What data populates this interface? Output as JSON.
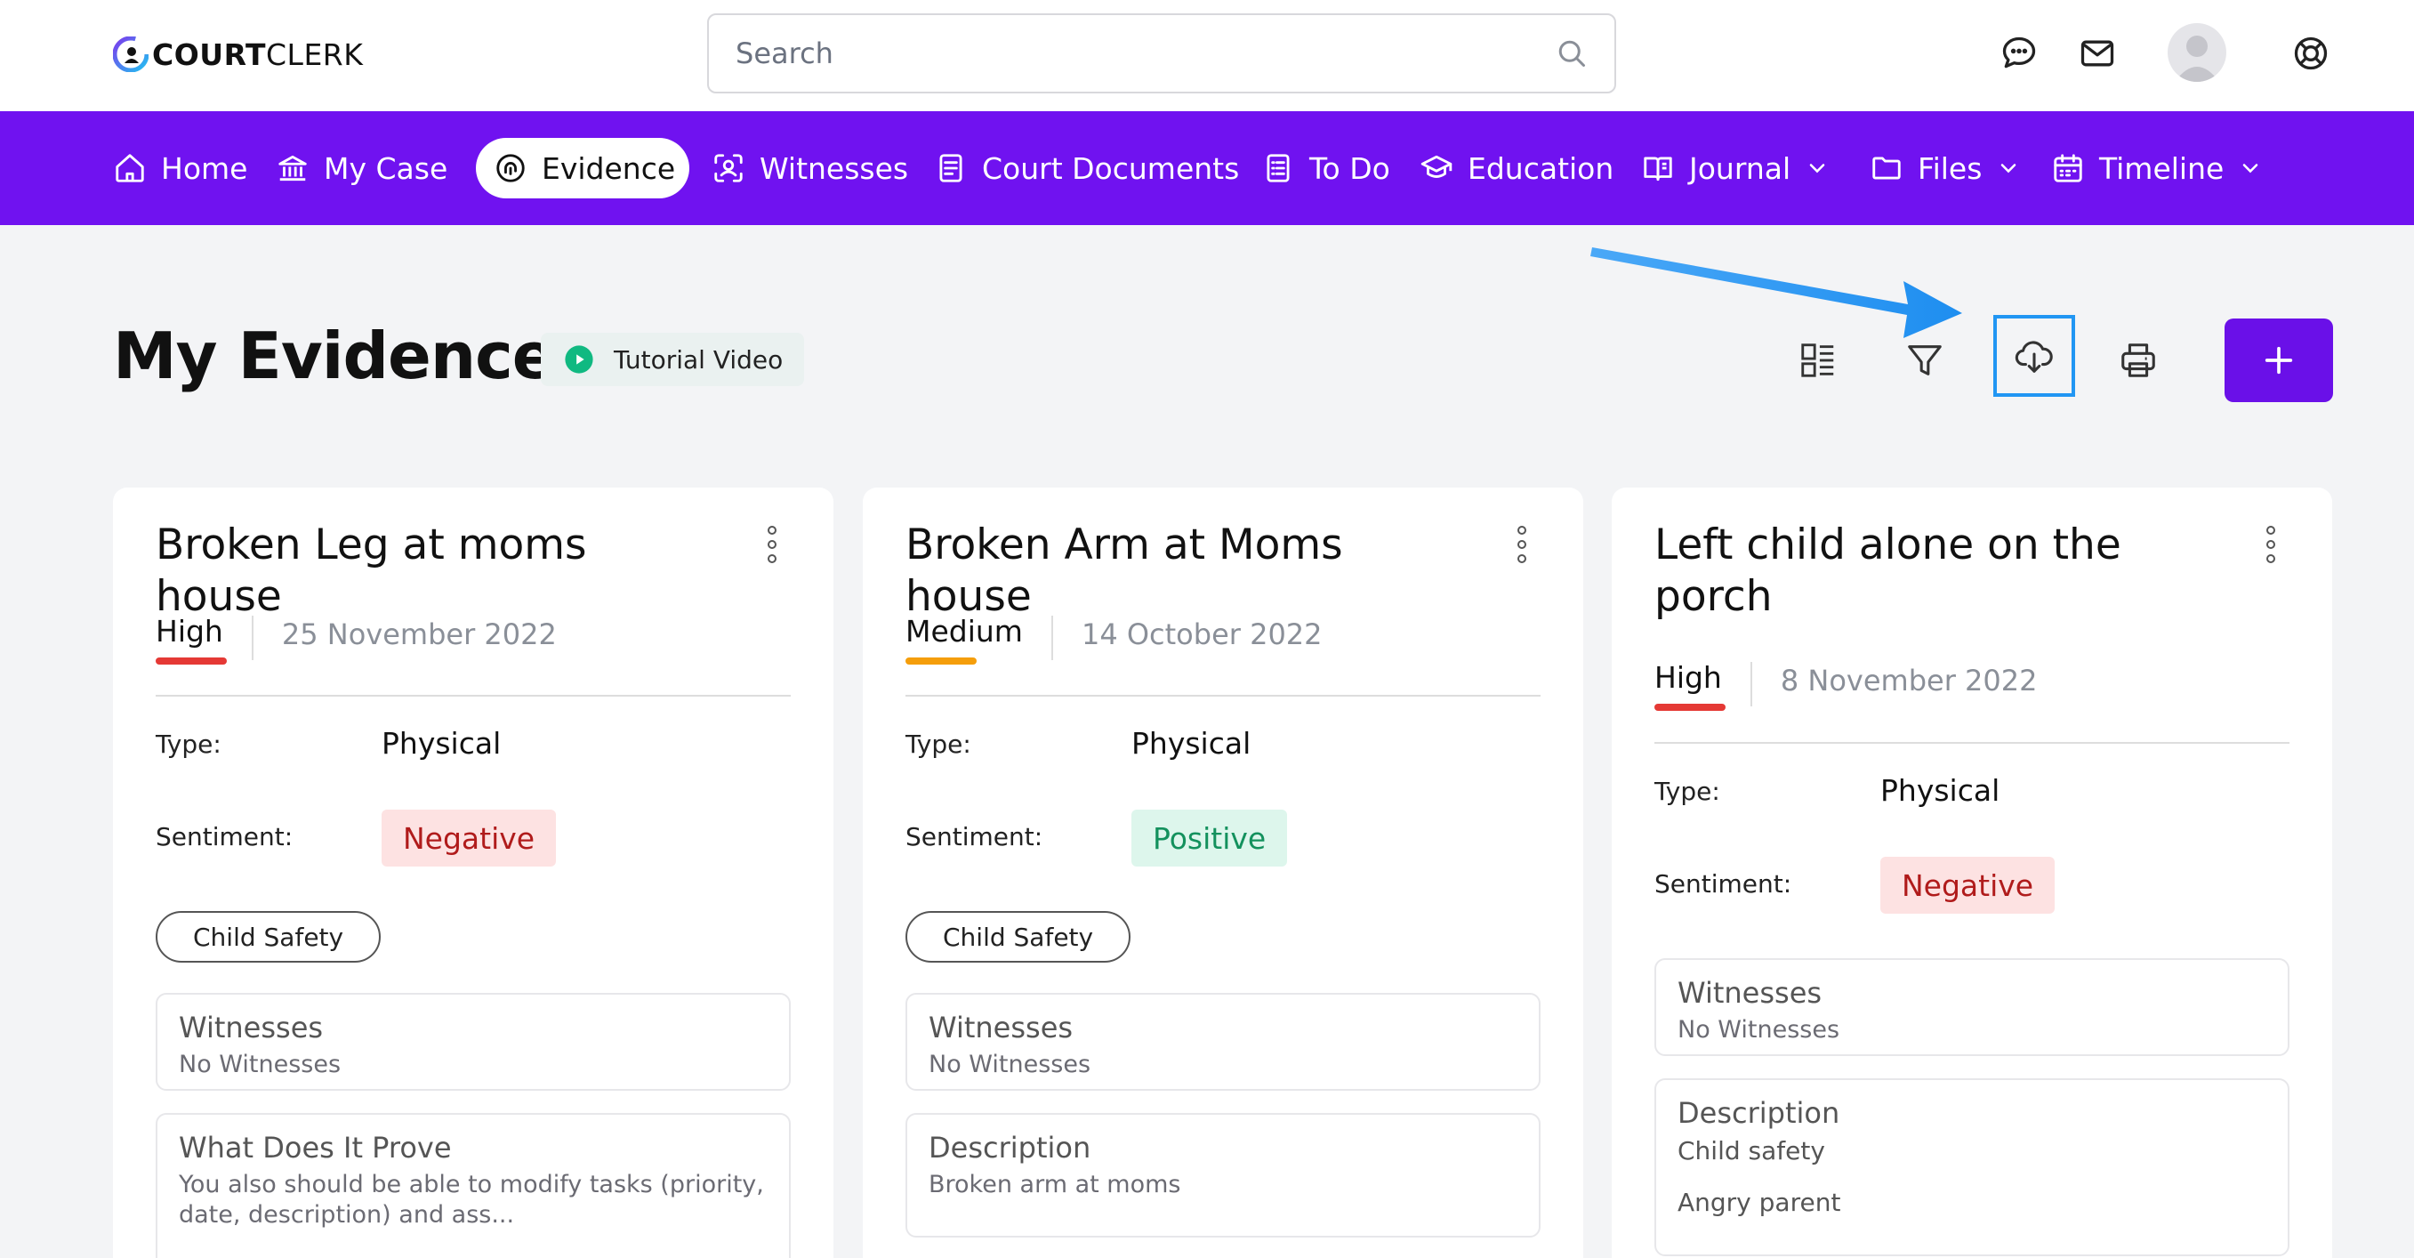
{
  "app": {
    "brand_bold": "COURT",
    "brand_light": "CLERK"
  },
  "search": {
    "placeholder": "Search"
  },
  "nav": {
    "items": [
      {
        "label": "Home"
      },
      {
        "label": "My Case"
      },
      {
        "label": "Evidence"
      },
      {
        "label": "Witnesses"
      },
      {
        "label": "Court Documents"
      },
      {
        "label": "To Do"
      },
      {
        "label": "Education"
      },
      {
        "label": "Journal"
      },
      {
        "label": "Files"
      },
      {
        "label": "Timeline"
      }
    ],
    "active": "Evidence"
  },
  "page": {
    "title": "My Evidence",
    "tutorial_label": "Tutorial Video"
  },
  "colors": {
    "brand": "#7012f0",
    "add_button": "#6a10e8",
    "highlight": "#2196f3",
    "priority_high": "#e53935",
    "priority_medium": "#f59e0b"
  },
  "cards": [
    {
      "title": "Broken Leg at moms house",
      "priority": "High",
      "date": "25 November 2022",
      "type_label": "Type:",
      "type_value": "Physical",
      "sentiment_label": "Sentiment:",
      "sentiment_value": "Negative",
      "tag": "Child Safety",
      "witnesses_title": "Witnesses",
      "witnesses_text": "No Witnesses",
      "box2_title": "What Does It Prove",
      "box2_text": "You also should be able to modify tasks (priority, date, description) and ass..."
    },
    {
      "title": "Broken Arm at Moms house",
      "priority": "Medium",
      "date": "14 October 2022",
      "type_label": "Type:",
      "type_value": "Physical",
      "sentiment_label": "Sentiment:",
      "sentiment_value": "Positive",
      "tag": "Child Safety",
      "witnesses_title": "Witnesses",
      "witnesses_text": "No Witnesses",
      "box2_title": "Description",
      "box2_text": "Broken arm at moms"
    },
    {
      "title": "Left child alone on the porch",
      "priority": "High",
      "date": "8 November 2022",
      "type_label": "Type:",
      "type_value": "Physical",
      "sentiment_label": "Sentiment:",
      "sentiment_value": "Negative",
      "witnesses_title": "Witnesses",
      "witnesses_text": "No Witnesses",
      "box2_title": "Description",
      "box2_line1": "Child safety",
      "box2_line2": "Angry parent"
    }
  ],
  "icons": {
    "search": "search-icon",
    "chat": "chat-icon",
    "mail": "mail-icon",
    "help": "lifebuoy-icon",
    "view": "list-view-icon",
    "filter": "filter-icon",
    "download": "cloud-download-icon",
    "print": "printer-icon",
    "add": "plus-icon"
  }
}
